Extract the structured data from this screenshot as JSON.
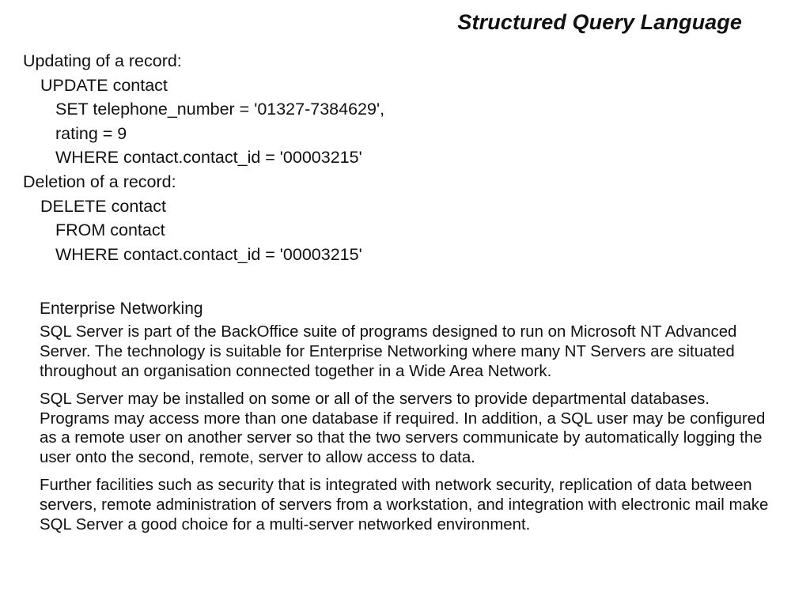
{
  "slide": {
    "title": "Structured Query Language"
  },
  "code_block": {
    "lines": [
      {
        "text": "Updating of a record:",
        "indent": 0
      },
      {
        "text": "UPDATE contact",
        "indent": 1
      },
      {
        "text": "SET telephone_number = '01327-7384629',",
        "indent": 2
      },
      {
        "text": "rating = 9",
        "indent": 2
      },
      {
        "text": "WHERE contact.contact_id = '00003215'",
        "indent": 2
      },
      {
        "text": "Deletion of a record:",
        "indent": 0
      },
      {
        "text": "DELETE contact",
        "indent": 1
      },
      {
        "text": "FROM contact",
        "indent": 2
      },
      {
        "text": "WHERE contact.contact_id = '00003215'",
        "indent": 2
      }
    ]
  },
  "prose": {
    "heading": "Enterprise Networking",
    "paragraphs": [
      "SQL Server is part of the BackOffice suite of programs designed to run on Microsoft NT Advanced Server. The technology is suitable for Enterprise Networking where many NT Servers are situated throughout an organisation connected together in a Wide Area Network.",
      "SQL Server may be installed on some or all of the servers to provide departmental databases. Programs may access more than one database if required. In addition, a SQL user may be configured as a remote user on another server so that the two servers communicate by automatically logging the user onto the second, remote, server to allow access to data.",
      "Further facilities such as security that is integrated with network security, replication of data between servers, remote administration of servers from a workstation, and integration with electronic mail make SQL Server a good choice for a multi-server networked environment."
    ]
  }
}
